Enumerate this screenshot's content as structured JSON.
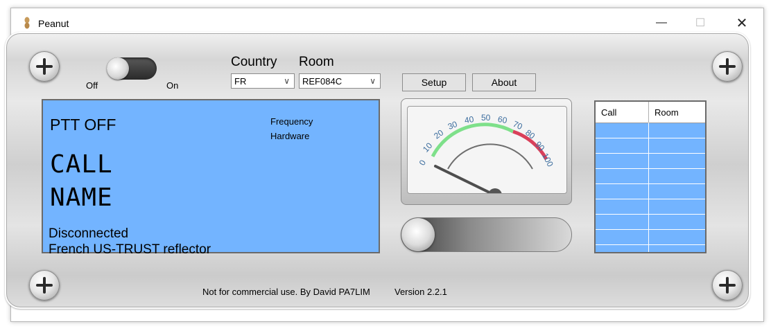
{
  "window": {
    "title": "Peanut",
    "minimize_glyph": "—",
    "maximize_glyph": "☐",
    "close_glyph": "✕"
  },
  "power": {
    "off_label": "Off",
    "on_label": "On",
    "state": "off"
  },
  "country": {
    "label": "Country",
    "value": "FR"
  },
  "room": {
    "label": "Room",
    "value": "REF084C"
  },
  "buttons": {
    "setup": "Setup",
    "about": "About"
  },
  "display": {
    "ptt": "PTT OFF",
    "frequency_label": "Frequency",
    "hardware_label": "Hardware",
    "call": "CALL",
    "name": "NAME",
    "status": "Disconnected",
    "description": "French US-TRUST reflector",
    "background_color": "#73b4ff"
  },
  "meter": {
    "scale": [
      "0",
      "10",
      "20",
      "30",
      "40",
      "50",
      "60",
      "70",
      "80",
      "90",
      "100"
    ],
    "green_color": "#7ee08a",
    "red_color": "#d9405a"
  },
  "table": {
    "headers": [
      "Call",
      "Room"
    ],
    "rows": []
  },
  "footer": {
    "credit": "Not for commercial use. By David PA7LIM",
    "version": "Version 2.2.1"
  }
}
